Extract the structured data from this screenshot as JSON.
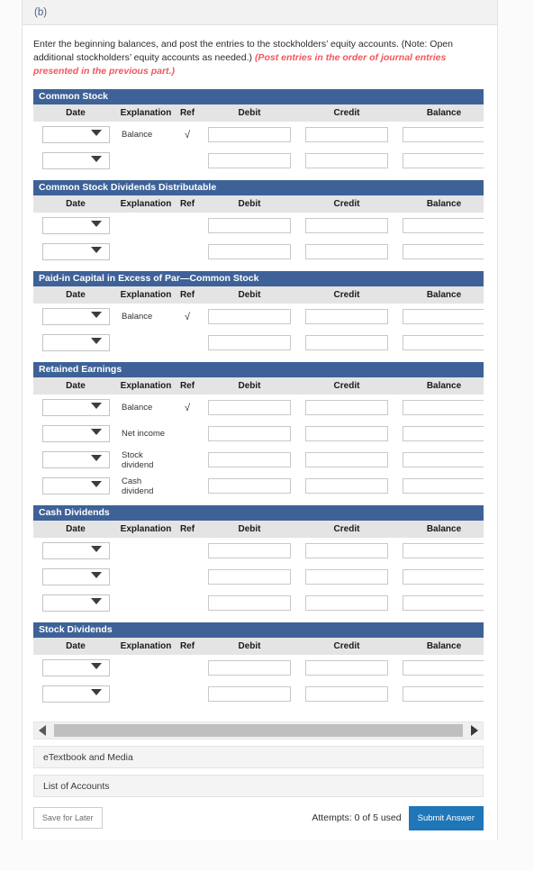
{
  "part": {
    "label": "(b)"
  },
  "instructions": {
    "text": "Enter the beginning balances, and post the entries to the stockholders’ equity accounts. (Note: Open additional stockholders’ equity accounts as needed.)",
    "emphasis": "(Post entries in the order of journal entries presented in the previous part.)"
  },
  "columns": {
    "date": "Date",
    "explanation": "Explanation",
    "ref": "Ref",
    "debit": "Debit",
    "credit": "Credit",
    "balance": "Balance"
  },
  "icons": {
    "chevron_down": "chevron-down-icon",
    "check": "√",
    "arrow_left": "triangle-left-icon",
    "arrow_right": "triangle-right-icon"
  },
  "accounts": [
    {
      "title": "Common Stock",
      "rows": [
        {
          "date": "",
          "explanation": "Balance",
          "ref": "√",
          "debit": "",
          "credit": "",
          "balance": ""
        },
        {
          "date": "",
          "explanation": "",
          "ref": "",
          "debit": "",
          "credit": "",
          "balance": ""
        }
      ]
    },
    {
      "title": "Common Stock Dividends Distributable",
      "rows": [
        {
          "date": "",
          "explanation": "",
          "ref": "",
          "debit": "",
          "credit": "",
          "balance": ""
        },
        {
          "date": "",
          "explanation": "",
          "ref": "",
          "debit": "",
          "credit": "",
          "balance": ""
        }
      ]
    },
    {
      "title": "Paid-in Capital in Excess of Par—Common Stock",
      "rows": [
        {
          "date": "",
          "explanation": "Balance",
          "ref": "√",
          "debit": "",
          "credit": "",
          "balance": ""
        },
        {
          "date": "",
          "explanation": "",
          "ref": "",
          "debit": "",
          "credit": "",
          "balance": ""
        }
      ]
    },
    {
      "title": "Retained Earnings",
      "rows": [
        {
          "date": "",
          "explanation": "Balance",
          "ref": "√",
          "debit": "",
          "credit": "",
          "balance": ""
        },
        {
          "date": "",
          "explanation": "Net income",
          "ref": "",
          "debit": "",
          "credit": "",
          "balance": ""
        },
        {
          "date": "",
          "explanation": "Stock dividend",
          "ref": "",
          "debit": "",
          "credit": "",
          "balance": ""
        },
        {
          "date": "",
          "explanation": "Cash dividend",
          "ref": "",
          "debit": "",
          "credit": "",
          "balance": ""
        }
      ]
    },
    {
      "title": "Cash Dividends",
      "rows": [
        {
          "date": "",
          "explanation": "",
          "ref": "",
          "debit": "",
          "credit": "",
          "balance": ""
        },
        {
          "date": "",
          "explanation": "",
          "ref": "",
          "debit": "",
          "credit": "",
          "balance": ""
        },
        {
          "date": "",
          "explanation": "",
          "ref": "",
          "debit": "",
          "credit": "",
          "balance": ""
        }
      ]
    },
    {
      "title": "Stock Dividends",
      "rows": [
        {
          "date": "",
          "explanation": "",
          "ref": "",
          "debit": "",
          "credit": "",
          "balance": ""
        },
        {
          "date": "",
          "explanation": "",
          "ref": "",
          "debit": "",
          "credit": "",
          "balance": ""
        }
      ]
    }
  ],
  "panels": [
    {
      "label": "eTextbook and Media"
    },
    {
      "label": "List of Accounts"
    }
  ],
  "footer": {
    "save_label": "Save for Later",
    "attempts": "Attempts: 0 of 5 used",
    "submit_label": "Submit Answer"
  },
  "colors": {
    "account_header": "#3e6298",
    "submit_button": "#1f76b8",
    "emphasis_text": "#f4565c",
    "column_header": "#e4e4e4"
  }
}
